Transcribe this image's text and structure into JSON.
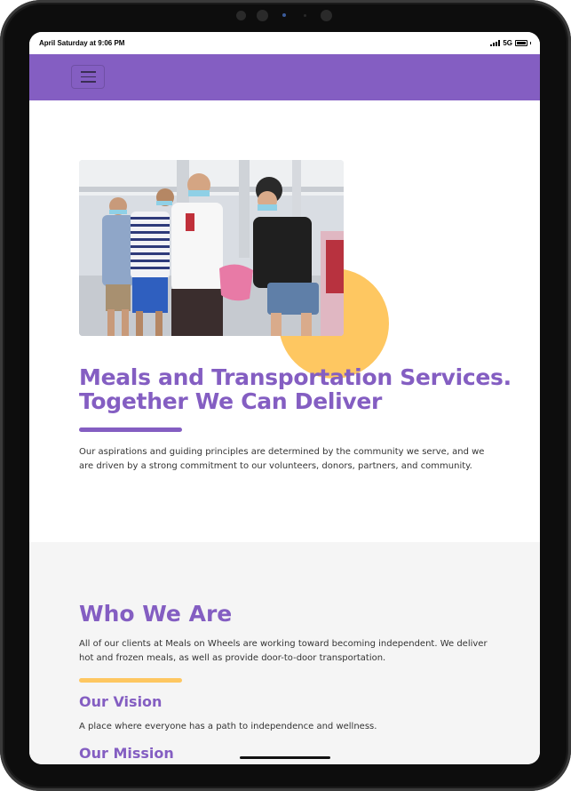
{
  "status_bar": {
    "time": "April Saturday at 9:06 PM",
    "network": "5G"
  },
  "navbar": {
    "menu_icon": "hamburger-icon",
    "color": "#845ec2"
  },
  "hero": {
    "image_alt": "Volunteers wearing masks distributing meal bags to seniors",
    "title_line1": "Meals and Transportation Services.",
    "title_line2": "Together We Can Deliver",
    "description": "Our aspirations and guiding principles are determined by the community we serve, and we are driven by a strong commitment to our volunteers, donors, partners, and community.",
    "accent_circle_color": "#fec761"
  },
  "about": {
    "title": "Who We Are",
    "description": "All of our clients at Meals on Wheels are working toward becoming independent. We deliver hot and frozen meals, as well as provide door-to-door transportation.",
    "vision_title": "Our Vision",
    "vision_text": "A place where everyone has a path to independence and wellness.",
    "mission_title": "Our Mission"
  },
  "colors": {
    "primary": "#845ec2",
    "accent": "#fec761",
    "section_bg": "#f5f5f5"
  }
}
